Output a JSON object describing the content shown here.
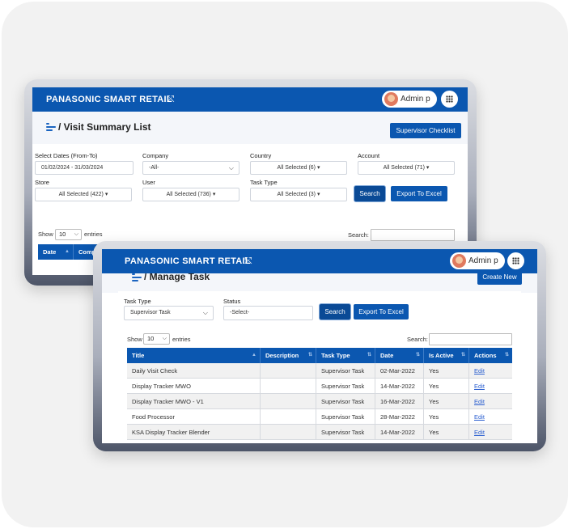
{
  "colors": {
    "primary": "#0b57b0",
    "page_bg": "#f2f2f2"
  },
  "window_back": {
    "brand": "PANASONIC SMART RETAIL",
    "user": "Admin p",
    "title": "Visit Summary List",
    "checklist_button": "Supervisor Checklist",
    "filters": {
      "dates_label": "Select Dates (From-To)",
      "dates_value": "01/02/2024 - 31/03/2024",
      "company_label": "Company",
      "company_value": "-All-",
      "country_label": "Country",
      "country_value": "All Selected (6) ▾",
      "account_label": "Account",
      "account_value": "All Selected (71) ▾",
      "store_label": "Store",
      "store_value": "All Selected (422) ▾",
      "user_label": "User",
      "user_value": "All Selected (736) ▾",
      "tasktype_label": "Task Type",
      "tasktype_value": "All Selected (3) ▾"
    },
    "search_button": "Search",
    "export_button": "Export To Excel",
    "show_label": "Show",
    "entries_value": "10",
    "entries_label": "entries",
    "search_label": "Search:",
    "columns": [
      "Date",
      "Compa"
    ]
  },
  "window_front": {
    "brand": "PANASONIC SMART RETAIL",
    "user": "Admin p",
    "title": "Manage Task",
    "create_button": "Create New",
    "tasktype_label": "Task Type",
    "tasktype_value": "Supervisor Task",
    "status_label": "Status",
    "status_value": "-Select-",
    "search_button": "Search",
    "export_button": "Export To Excel",
    "show_label": "Show",
    "entries_value": "10",
    "entries_label": "entries",
    "search_label": "Search:",
    "columns": [
      "Title",
      "Description",
      "Task Type",
      "Date",
      "Is Active",
      "Actions"
    ],
    "rows": [
      {
        "title": "Daily Visit Check",
        "description": "",
        "task_type": "Supervisor Task",
        "date": "02-Mar-2022",
        "active": "Yes",
        "action": "Edit"
      },
      {
        "title": "Display Tracker MWO",
        "description": "",
        "task_type": "Supervisor Task",
        "date": "14-Mar-2022",
        "active": "Yes",
        "action": "Edit"
      },
      {
        "title": "Display Tracker MWO - V1",
        "description": "",
        "task_type": "Supervisor Task",
        "date": "16-Mar-2022",
        "active": "Yes",
        "action": "Edit"
      },
      {
        "title": "Food Processor",
        "description": "",
        "task_type": "Supervisor Task",
        "date": "28-Mar-2022",
        "active": "Yes",
        "action": "Edit"
      },
      {
        "title": "KSA Display Tracker Blender",
        "description": "",
        "task_type": "Supervisor Task",
        "date": "14-Mar-2022",
        "active": "Yes",
        "action": "Edit"
      }
    ]
  }
}
